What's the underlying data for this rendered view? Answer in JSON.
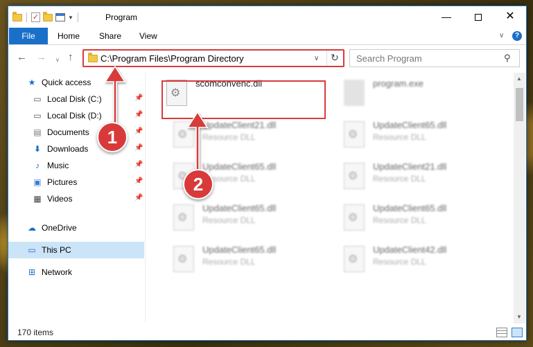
{
  "window": {
    "title": "Program",
    "minimize": "—",
    "close": "✕"
  },
  "ribbon": {
    "tabs": [
      "File",
      "Home",
      "Share",
      "View"
    ]
  },
  "address": {
    "path": "C:\\Program Files\\Program Directory"
  },
  "search": {
    "placeholder": "Search Program"
  },
  "sidebar": {
    "items": [
      {
        "label": "Quick access",
        "icon": "star-icon"
      },
      {
        "label": "Local Disk (C:)",
        "icon": "drive-icon",
        "pinned": true
      },
      {
        "label": "Local Disk (D:)",
        "icon": "drive-icon",
        "pinned": true
      },
      {
        "label": "Documents",
        "icon": "documents-icon",
        "pinned": true
      },
      {
        "label": "Downloads",
        "icon": "download-icon",
        "pinned": true
      },
      {
        "label": "Music",
        "icon": "music-icon",
        "pinned": true
      },
      {
        "label": "Pictures",
        "icon": "pictures-icon",
        "pinned": true
      },
      {
        "label": "Videos",
        "icon": "videos-icon",
        "pinned": true
      },
      {
        "label": "OneDrive",
        "icon": "cloud-icon"
      },
      {
        "label": "This PC",
        "icon": "computer-icon",
        "selected": true
      },
      {
        "label": "Network",
        "icon": "network-icon"
      }
    ]
  },
  "files": [
    {
      "name": "scomconvenc.dll",
      "type": ""
    },
    {
      "name": "program.exe",
      "type": ""
    },
    {
      "name": "UpdateClient21.dll",
      "type": "Resource DLL"
    },
    {
      "name": "UpdateClient65.dll",
      "type": "Resource DLL"
    },
    {
      "name": "UpdateClient65.dll",
      "type": "Resource DLL"
    },
    {
      "name": "UpdateClient21.dll",
      "type": "Resource DLL"
    },
    {
      "name": "UpdateClient65.dll",
      "type": "Resource DLL"
    },
    {
      "name": "UpdateClient65.dll",
      "type": "Resource DLL"
    },
    {
      "name": "UpdateClient65.dll",
      "type": "Resource DLL"
    },
    {
      "name": "UpdateClient42.dll",
      "type": "Resource DLL"
    }
  ],
  "status": {
    "item_count": "170 items"
  },
  "callouts": {
    "one": "1",
    "two": "2"
  },
  "colors": {
    "accent": "#1a6fc9",
    "highlight": "#d93a3a",
    "selected": "#cce4f7"
  }
}
